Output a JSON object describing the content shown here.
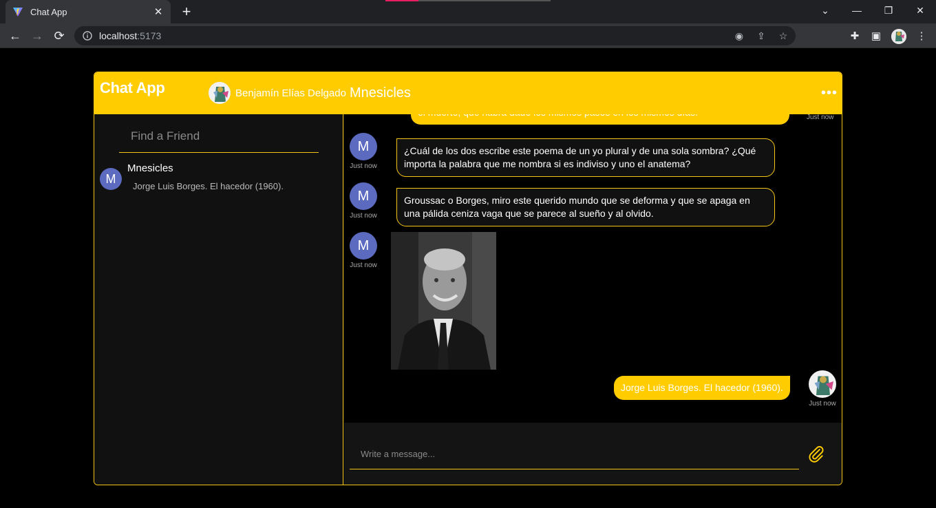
{
  "browser": {
    "tab_title": "Chat App",
    "url_host": "localhost",
    "url_port": ":5173"
  },
  "app": {
    "brand": "Chat App",
    "current_user": "Benjamín Elías Delgado",
    "chat_title": "Mnesicles",
    "search_placeholder": "Find a Friend",
    "composer_placeholder": "Write a message...",
    "accent_color": "#ffcc00"
  },
  "friends": [
    {
      "name": "Mnesicles",
      "initial": "M",
      "last_message": "Jorge Luis Borges. El hacedor (1960)."
    }
  ],
  "messages": [
    {
      "from": "me",
      "text": "el muerto, que habrá dado los mismos pasos en los mismos días.",
      "time": "Just now"
    },
    {
      "from": "friend",
      "initial": "M",
      "text": "¿Cuál de los dos escribe este poema de un yo plural y de una sola sombra? ¿Qué importa la palabra que me nombra si es indiviso y uno el anatema?",
      "time": "Just now"
    },
    {
      "from": "friend",
      "initial": "M",
      "text": "Groussac o Borges, miro este querido mundo que se deforma y que se apaga en una pálida ceniza vaga que se parece al sueño y al olvido.",
      "time": "Just now"
    },
    {
      "from": "friend",
      "initial": "M",
      "text": "",
      "time": "Just now"
    },
    {
      "from": "me",
      "text": "Jorge Luis Borges. El hacedor (1960).",
      "time": "Just now"
    }
  ]
}
